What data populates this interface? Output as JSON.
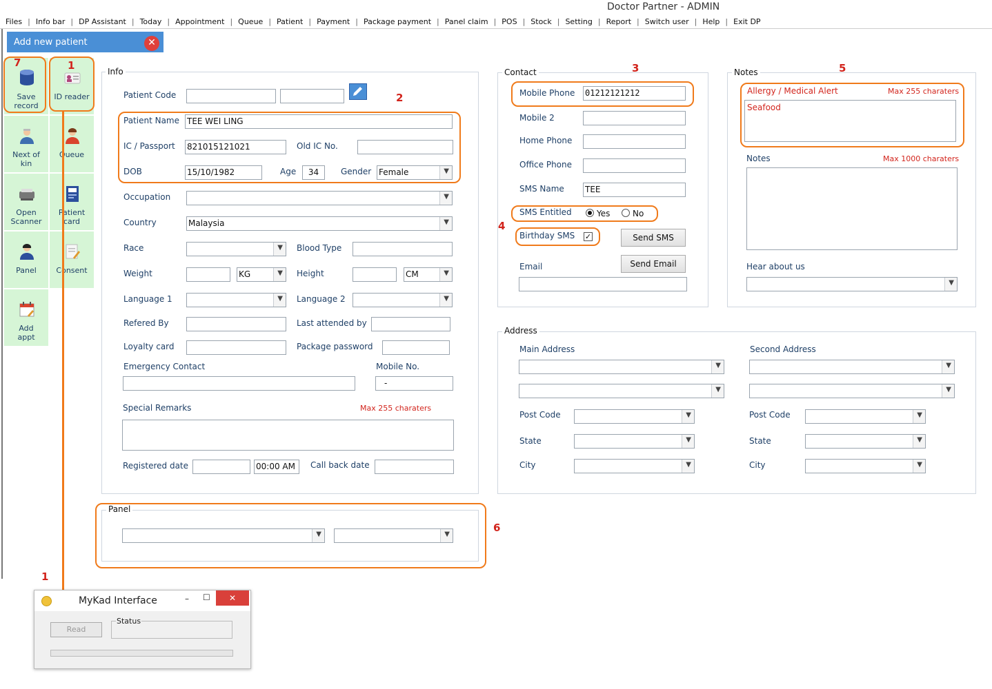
{
  "window_title": "Doctor Partner - ADMIN",
  "menu": [
    "Files",
    "Info bar",
    "DP Assistant",
    "Today",
    "Appointment",
    "Queue",
    "Patient",
    "Payment",
    "Package payment",
    "Panel claim",
    "POS",
    "Stock",
    "Setting",
    "Report",
    "Switch user",
    "Help",
    "Exit DP"
  ],
  "tab": {
    "title": "Add new patient"
  },
  "sidebar": [
    {
      "label": "Save\nrecord",
      "icon": "database-icon"
    },
    {
      "label": "ID reader",
      "icon": "id-card-icon"
    },
    {
      "label": "Next of\nkin",
      "icon": "person-icon"
    },
    {
      "label": "Queue",
      "icon": "queue-person-icon"
    },
    {
      "label": "Open\nScanner",
      "icon": "scanner-icon"
    },
    {
      "label": "Patient\ncard",
      "icon": "patient-card-icon"
    },
    {
      "label": "Panel",
      "icon": "panel-person-icon"
    },
    {
      "label": "Consent",
      "icon": "consent-document-icon"
    },
    {
      "label": "Add\nappt",
      "icon": "calendar-icon"
    }
  ],
  "annotations": {
    "n1": "1",
    "n2": "2",
    "n3": "3",
    "n4": "4",
    "n5": "5",
    "n6": "6",
    "n7": "7"
  },
  "info": {
    "title": "Info",
    "patient_code": "Patient Code",
    "patient_name": "Patient Name",
    "patient_name_val": "TEE WEI LING",
    "ic": "IC / Passport",
    "ic_val": "821015121021",
    "old_ic": "Old IC No.",
    "dob": "DOB",
    "dob_val": "15/10/1982",
    "age": "Age",
    "age_val": "34",
    "gender": "Gender",
    "gender_val": "Female",
    "occupation": "Occupation",
    "country": "Country",
    "country_val": "Malaysia",
    "race": "Race",
    "blood": "Blood Type",
    "weight": "Weight",
    "weight_unit": "KG",
    "height": "Height",
    "height_unit": "CM",
    "lang1": "Language 1",
    "lang2": "Language 2",
    "referred": "Refered By",
    "last_attended": "Last attended by",
    "loyalty": "Loyalty card",
    "pkg_pw": "Package password",
    "emergency": "Emergency Contact",
    "mobile_no": "Mobile No.",
    "mobile_no_val": "-",
    "remarks": "Special Remarks",
    "remarks_max": "Max 255 charaters",
    "registered": "Registered date",
    "time_val": "00:00 AM",
    "callback": "Call back date"
  },
  "contact": {
    "title": "Contact",
    "mobile": "Mobile Phone",
    "mobile_val": "01212121212",
    "mobile2": "Mobile 2",
    "home": "Home Phone",
    "office": "Office Phone",
    "sms_name": "SMS Name",
    "sms_name_val": "TEE",
    "sms_entitled": "SMS Entitled",
    "yes": "Yes",
    "no": "No",
    "birthday": "Birthday SMS",
    "check": "✓",
    "send_sms": "Send SMS",
    "send_email": "Send Email",
    "email": "Email"
  },
  "notes": {
    "title": "Notes",
    "allergy": "Allergy / Medical Alert",
    "allergy_max": "Max 255 charaters",
    "allergy_val": "Seafood",
    "notes": "Notes",
    "notes_max": "Max 1000 charaters",
    "hear": "Hear about us"
  },
  "address": {
    "title": "Address",
    "main": "Main Address",
    "second": "Second Address",
    "postcode": "Post Code",
    "state": "State",
    "city": "City"
  },
  "panel": {
    "title": "Panel"
  },
  "mykad": {
    "title": "MyKad Interface",
    "read": "Read",
    "status": "Status",
    "min": "–",
    "max": "☐",
    "close": "✕"
  },
  "colors": {
    "accent": "#4a8fd6",
    "highlight": "#f07a1a",
    "alert": "#d2241c",
    "tile": "#d6f5d6"
  }
}
